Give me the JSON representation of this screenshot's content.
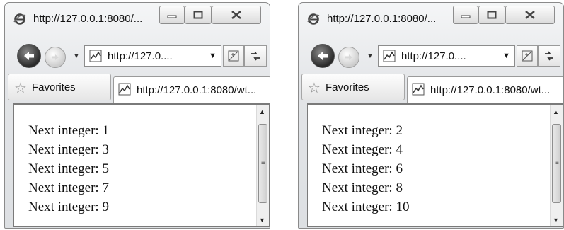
{
  "windows": [
    {
      "title": "http://127.0.0.1:8080/...",
      "address": "http://127.0....",
      "favorites_label": "Favorites",
      "tab_label": "http://127.0.0.1:8080/wt...",
      "lines": [
        "Next integer: 1",
        "Next integer: 3",
        "Next integer: 5",
        "Next integer: 7",
        "Next integer: 9"
      ]
    },
    {
      "title": "http://127.0.0.1:8080/...",
      "address": "http://127.0....",
      "favorites_label": "Favorites",
      "tab_label": "http://127.0.0.1:8080/wt...",
      "lines": [
        "Next integer: 2",
        "Next integer: 4",
        "Next integer: 6",
        "Next integer: 8",
        "Next integer: 10"
      ]
    }
  ],
  "icons": {
    "ie": "ie-logo-icon",
    "back": "back-arrow-icon",
    "forward": "forward-arrow-icon",
    "compat": "compatibility-view-icon",
    "refresh": "refresh-icon",
    "star": "favorites-star-icon",
    "page": "page-favicon-icon"
  }
}
